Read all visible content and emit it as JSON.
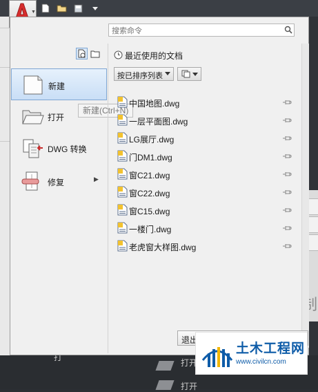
{
  "app_menu": {
    "search_placeholder": "搜索命令",
    "commands": [
      {
        "label": "新建",
        "icon": "new-document-icon"
      },
      {
        "label": "打开",
        "icon": "open-folder-icon"
      },
      {
        "label": "DWG 转换",
        "icon": "dwg-convert-icon"
      },
      {
        "label": "修复",
        "icon": "repair-icon",
        "has_submenu": true
      }
    ],
    "tooltip": "新建(Ctrl+N)",
    "recent": {
      "title": "最近使用的文档",
      "sort_label": "按已排序列表",
      "documents": [
        "中国地图.dwg",
        "一层平面图.dwg",
        "LG展厅.dwg",
        "门DM1.dwg",
        "窗C21.dwg",
        "窗C22.dwg",
        "窗C15.dwg",
        "一楼门.dwg",
        "老虎窗大样图.dwg"
      ]
    },
    "exit_label": "退出"
  },
  "background": {
    "right_panel_char": "制",
    "right_top_label": "A",
    "bottom_texts": [
      "打开",
      "打开",
      "打"
    ]
  },
  "watermark": {
    "brand": "土木工程网",
    "url": "www.civilcn.com"
  },
  "colors": {
    "accent_red": "#d62d2d",
    "selection_blue": "#c9def6",
    "watermark_blue": "#0e5ca8"
  }
}
